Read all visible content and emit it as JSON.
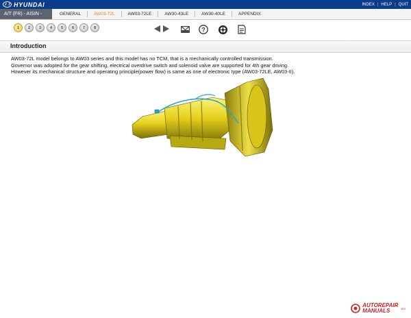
{
  "header": {
    "brand": "HYUNDAI",
    "links": [
      "INDEX",
      "HELP",
      "QUIT"
    ]
  },
  "nav": {
    "model_select": "A/T (FR) - AISIN -",
    "tabs": [
      "GENERAL",
      "AW03-72L",
      "AW03-72LE",
      "AW30-43LE",
      "AW30-40LE",
      "APPENDIX"
    ],
    "active_tab": "AW03-72L"
  },
  "toolbar": {
    "steps": [
      "1",
      "2",
      "3",
      "4",
      "5",
      "6",
      "7",
      "8"
    ],
    "active_step": "1",
    "icons": [
      "prev-next-arrows-icon",
      "mail-icon",
      "help-icon",
      "wheel-icon",
      "print-icon"
    ]
  },
  "content": {
    "section_title": "Introduction",
    "paragraph": [
      "AW03-72L model belongs to AW03 series and this model has no TCM, that is a mechanically controlled transmission.",
      "Governor was adopted for the gear shifting, electrical overdrive switch and solenoid valve are supported for 4th gear driving.",
      "However its mechanical structure and operating principle(power flow) is same as one of electronic type (AW03-72LE, AW03-II)."
    ]
  },
  "watermark": {
    "line1": "AUTOREPAIR",
    "line2": "MANUALS",
    "suffix": ".WS"
  },
  "colors": {
    "header_bg": "#0b3c8c",
    "active_tab": "#e08a12",
    "transmission_yellow": "#e6d21a",
    "watermark_red": "#cc2222"
  }
}
